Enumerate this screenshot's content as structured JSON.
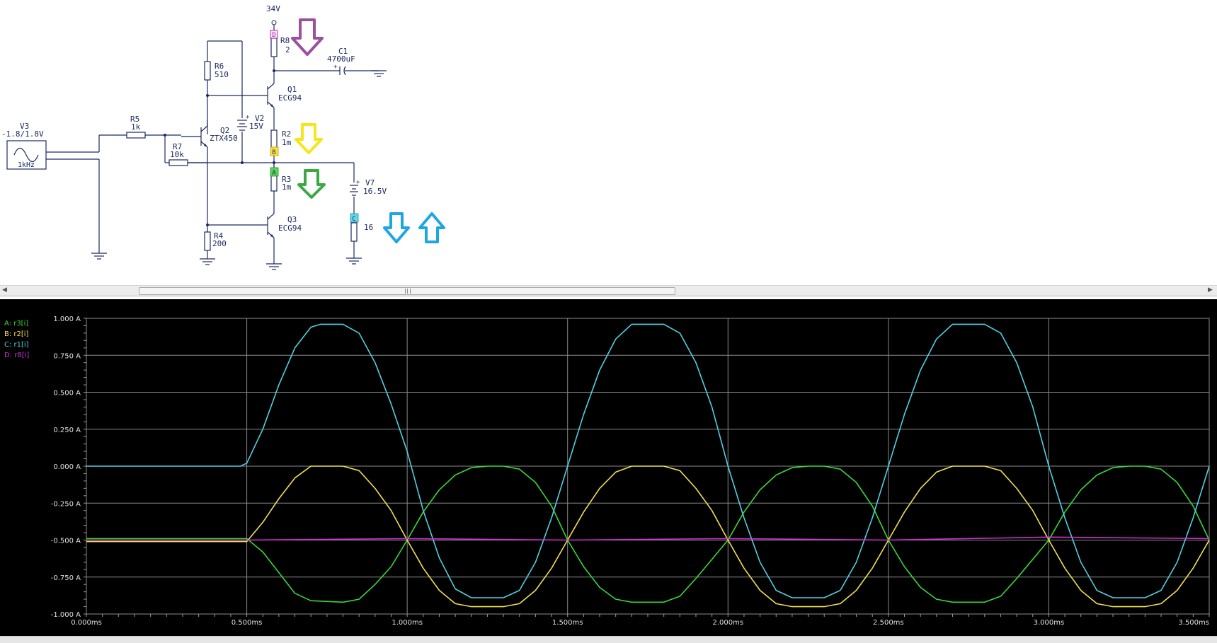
{
  "schematic": {
    "supply_label": "34V",
    "components": {
      "r8": {
        "name": "R8",
        "value": "2"
      },
      "c1": {
        "name": "C1",
        "value": "4700uF"
      },
      "r6": {
        "name": "R6",
        "value": "510"
      },
      "q1": {
        "name": "Q1",
        "value": "ECG94"
      },
      "v2": {
        "name": "V2",
        "value": "15V"
      },
      "r2": {
        "name": "R2",
        "value": "1m"
      },
      "v3": {
        "name": "V3",
        "value": "-1.8/1.8V",
        "freq": "1kHz"
      },
      "r5": {
        "name": "R5",
        "value": "1k"
      },
      "q2": {
        "name": "Q2",
        "value": "ZTX450"
      },
      "r7": {
        "name": "R7",
        "value": "10k"
      },
      "r3": {
        "name": "R3",
        "value": "1m"
      },
      "v7": {
        "name": "V7",
        "value": "16.5V"
      },
      "q3": {
        "name": "Q3",
        "value": "ECG94"
      },
      "r4": {
        "name": "R4",
        "value": "200"
      },
      "r1": {
        "value": "16"
      }
    },
    "probes": {
      "a": "A",
      "b": "B",
      "c": "C",
      "d": "D"
    },
    "plus_sign": "+"
  },
  "colors": {
    "purple_arrow": "#9b4f9e",
    "yellow_arrow": "#f5e61b",
    "green_arrow": "#3aa943",
    "blue_arrow": "#1ea6e0"
  },
  "chart_data": {
    "type": "line",
    "title": "",
    "xlabel": "",
    "ylabel": "",
    "xlim": [
      0,
      3.5
    ],
    "ylim": [
      -1,
      1
    ],
    "grid": true,
    "legend_position": "top-left",
    "x_ticks": [
      "0.000ms",
      "0.500ms",
      "1.000ms",
      "1.500ms",
      "2.000ms",
      "2.500ms",
      "3.000ms",
      "3.500ms"
    ],
    "y_ticks": [
      "1.000 A",
      "0.750 A",
      "0.500 A",
      "0.250 A",
      "0.000 A",
      "-0.250 A",
      "-0.500 A",
      "-0.750 A",
      "-1.000 A"
    ],
    "series": [
      {
        "name": "A: r3[i]",
        "color": "#3ad63a",
        "points": [
          [
            0,
            -0.49
          ],
          [
            0.5,
            -0.49
          ],
          [
            0.55,
            -0.58
          ],
          [
            0.6,
            -0.72
          ],
          [
            0.65,
            -0.86
          ],
          [
            0.7,
            -0.91
          ],
          [
            0.8,
            -0.92
          ],
          [
            0.85,
            -0.9
          ],
          [
            0.9,
            -0.8
          ],
          [
            0.95,
            -0.68
          ],
          [
            1.0,
            -0.5
          ],
          [
            1.05,
            -0.31
          ],
          [
            1.1,
            -0.16
          ],
          [
            1.15,
            -0.06
          ],
          [
            1.2,
            -0.01
          ],
          [
            1.25,
            0.0
          ],
          [
            1.3,
            0.0
          ],
          [
            1.35,
            -0.02
          ],
          [
            1.4,
            -0.11
          ],
          [
            1.45,
            -0.27
          ],
          [
            1.5,
            -0.5
          ],
          [
            1.55,
            -0.68
          ],
          [
            1.6,
            -0.82
          ],
          [
            1.65,
            -0.9
          ],
          [
            1.7,
            -0.92
          ],
          [
            1.8,
            -0.92
          ],
          [
            1.85,
            -0.88
          ],
          [
            1.9,
            -0.76
          ],
          [
            1.95,
            -0.63
          ],
          [
            2.0,
            -0.5
          ],
          [
            2.05,
            -0.31
          ],
          [
            2.1,
            -0.16
          ],
          [
            2.15,
            -0.06
          ],
          [
            2.2,
            -0.01
          ],
          [
            2.25,
            0.0
          ],
          [
            2.3,
            0.0
          ],
          [
            2.35,
            -0.02
          ],
          [
            2.4,
            -0.11
          ],
          [
            2.45,
            -0.27
          ],
          [
            2.5,
            -0.5
          ],
          [
            2.55,
            -0.68
          ],
          [
            2.6,
            -0.82
          ],
          [
            2.65,
            -0.9
          ],
          [
            2.7,
            -0.92
          ],
          [
            2.8,
            -0.92
          ],
          [
            2.85,
            -0.88
          ],
          [
            2.9,
            -0.76
          ],
          [
            2.95,
            -0.63
          ],
          [
            3.0,
            -0.5
          ],
          [
            3.05,
            -0.31
          ],
          [
            3.1,
            -0.16
          ],
          [
            3.15,
            -0.06
          ],
          [
            3.2,
            -0.01
          ],
          [
            3.25,
            0.0
          ],
          [
            3.3,
            0.0
          ],
          [
            3.35,
            -0.02
          ],
          [
            3.4,
            -0.11
          ],
          [
            3.45,
            -0.27
          ],
          [
            3.5,
            -0.5
          ]
        ]
      },
      {
        "name": "B: r2[i]",
        "color": "#f0e050",
        "points": [
          [
            0,
            -0.51
          ],
          [
            0.5,
            -0.51
          ],
          [
            0.55,
            -0.38
          ],
          [
            0.6,
            -0.22
          ],
          [
            0.65,
            -0.08
          ],
          [
            0.7,
            0.0
          ],
          [
            0.8,
            0.0
          ],
          [
            0.85,
            -0.03
          ],
          [
            0.9,
            -0.15
          ],
          [
            0.95,
            -0.3
          ],
          [
            1.0,
            -0.5
          ],
          [
            1.05,
            -0.69
          ],
          [
            1.1,
            -0.84
          ],
          [
            1.15,
            -0.93
          ],
          [
            1.2,
            -0.95
          ],
          [
            1.3,
            -0.95
          ],
          [
            1.35,
            -0.93
          ],
          [
            1.4,
            -0.84
          ],
          [
            1.45,
            -0.69
          ],
          [
            1.5,
            -0.5
          ],
          [
            1.55,
            -0.31
          ],
          [
            1.6,
            -0.15
          ],
          [
            1.65,
            -0.04
          ],
          [
            1.7,
            0.0
          ],
          [
            1.8,
            0.0
          ],
          [
            1.85,
            -0.03
          ],
          [
            1.9,
            -0.15
          ],
          [
            1.95,
            -0.3
          ],
          [
            2.0,
            -0.5
          ],
          [
            2.05,
            -0.69
          ],
          [
            2.1,
            -0.84
          ],
          [
            2.15,
            -0.93
          ],
          [
            2.2,
            -0.95
          ],
          [
            2.3,
            -0.95
          ],
          [
            2.35,
            -0.93
          ],
          [
            2.4,
            -0.84
          ],
          [
            2.45,
            -0.69
          ],
          [
            2.5,
            -0.5
          ],
          [
            2.55,
            -0.31
          ],
          [
            2.6,
            -0.15
          ],
          [
            2.65,
            -0.04
          ],
          [
            2.7,
            0.0
          ],
          [
            2.8,
            0.0
          ],
          [
            2.85,
            -0.03
          ],
          [
            2.9,
            -0.15
          ],
          [
            2.95,
            -0.3
          ],
          [
            3.0,
            -0.5
          ],
          [
            3.05,
            -0.69
          ],
          [
            3.1,
            -0.84
          ],
          [
            3.15,
            -0.93
          ],
          [
            3.2,
            -0.95
          ],
          [
            3.3,
            -0.95
          ],
          [
            3.35,
            -0.93
          ],
          [
            3.4,
            -0.84
          ],
          [
            3.45,
            -0.69
          ],
          [
            3.5,
            -0.5
          ]
        ]
      },
      {
        "name": "C: r1[i]",
        "color": "#50d0e0",
        "points": [
          [
            0,
            0.0
          ],
          [
            0.48,
            0.0
          ],
          [
            0.5,
            0.02
          ],
          [
            0.55,
            0.25
          ],
          [
            0.6,
            0.55
          ],
          [
            0.65,
            0.8
          ],
          [
            0.7,
            0.94
          ],
          [
            0.73,
            0.96
          ],
          [
            0.8,
            0.96
          ],
          [
            0.85,
            0.9
          ],
          [
            0.9,
            0.7
          ],
          [
            0.95,
            0.42
          ],
          [
            1.0,
            0.1
          ],
          [
            1.05,
            -0.3
          ],
          [
            1.1,
            -0.62
          ],
          [
            1.15,
            -0.83
          ],
          [
            1.2,
            -0.89
          ],
          [
            1.3,
            -0.89
          ],
          [
            1.35,
            -0.84
          ],
          [
            1.4,
            -0.65
          ],
          [
            1.45,
            -0.35
          ],
          [
            1.5,
            0.0
          ],
          [
            1.55,
            0.35
          ],
          [
            1.6,
            0.65
          ],
          [
            1.65,
            0.86
          ],
          [
            1.7,
            0.96
          ],
          [
            1.8,
            0.96
          ],
          [
            1.85,
            0.9
          ],
          [
            1.9,
            0.7
          ],
          [
            1.95,
            0.4
          ],
          [
            2.0,
            0.0
          ],
          [
            2.05,
            -0.35
          ],
          [
            2.1,
            -0.65
          ],
          [
            2.15,
            -0.84
          ],
          [
            2.2,
            -0.89
          ],
          [
            2.3,
            -0.89
          ],
          [
            2.35,
            -0.84
          ],
          [
            2.4,
            -0.65
          ],
          [
            2.45,
            -0.35
          ],
          [
            2.5,
            0.0
          ],
          [
            2.55,
            0.35
          ],
          [
            2.6,
            0.65
          ],
          [
            2.65,
            0.86
          ],
          [
            2.7,
            0.96
          ],
          [
            2.8,
            0.96
          ],
          [
            2.85,
            0.9
          ],
          [
            2.9,
            0.7
          ],
          [
            2.95,
            0.4
          ],
          [
            3.0,
            0.0
          ],
          [
            3.05,
            -0.35
          ],
          [
            3.1,
            -0.65
          ],
          [
            3.15,
            -0.84
          ],
          [
            3.2,
            -0.89
          ],
          [
            3.3,
            -0.89
          ],
          [
            3.35,
            -0.84
          ],
          [
            3.4,
            -0.65
          ],
          [
            3.45,
            -0.35
          ],
          [
            3.5,
            0.0
          ]
        ]
      },
      {
        "name": "D: r8[i]",
        "color": "#d030d0",
        "points": [
          [
            0,
            -0.5
          ],
          [
            0.5,
            -0.5
          ],
          [
            1.0,
            -0.49
          ],
          [
            1.5,
            -0.5
          ],
          [
            2.0,
            -0.49
          ],
          [
            2.5,
            -0.5
          ],
          [
            3.0,
            -0.48
          ],
          [
            3.5,
            -0.49
          ]
        ]
      }
    ]
  }
}
